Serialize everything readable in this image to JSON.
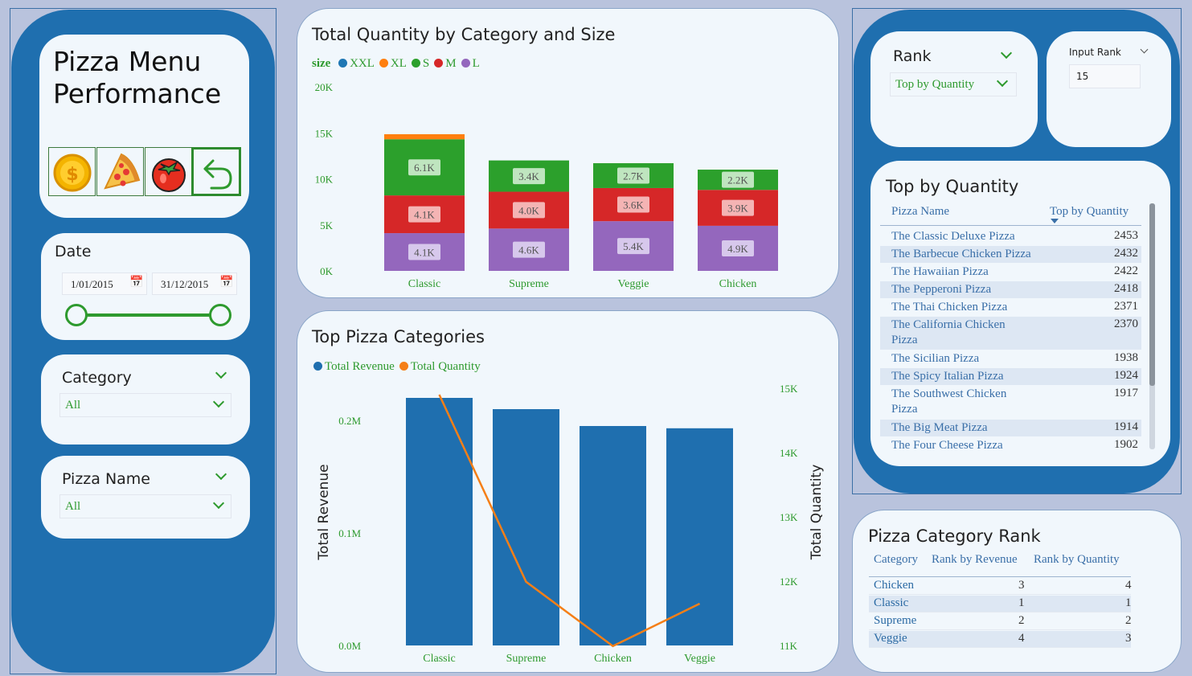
{
  "title": "Pizza Menu Performance",
  "nav_buttons": [
    {
      "icon": "coin-icon"
    },
    {
      "icon": "pizza-slice-icon"
    },
    {
      "icon": "tomato-icon"
    },
    {
      "icon": "back-arrow-icon"
    }
  ],
  "date_slicer": {
    "title": "Date",
    "start": "1/01/2015",
    "end": "31/12/2015"
  },
  "category_slicer": {
    "title": "Category",
    "value": "All"
  },
  "pizza_name_slicer": {
    "title": "Pizza Name",
    "value": "All"
  },
  "chart1": {
    "title": "Total Quantity by Category and Size",
    "legend_title": "size",
    "chart_data": {
      "type": "bar",
      "categories": [
        "Classic",
        "Supreme",
        "Veggie",
        "Chicken"
      ],
      "ylim": [
        0,
        20000
      ],
      "y_ticks": [
        "0K",
        "5K",
        "10K",
        "15K",
        "20K"
      ],
      "series": [
        {
          "name": "XXL",
          "color": "#1f77b4",
          "values": [
            0,
            0,
            0,
            0
          ]
        },
        {
          "name": "XL",
          "color": "#ff7f0e",
          "values": [
            550,
            0,
            0,
            0
          ]
        },
        {
          "name": "S",
          "color": "#2ca02c",
          "values": [
            6100,
            3400,
            2700,
            2200
          ],
          "labels": [
            "6.1K",
            "3.4K",
            "2.7K",
            "2.2K"
          ]
        },
        {
          "name": "M",
          "color": "#d62728",
          "values": [
            4100,
            4000,
            3600,
            3900
          ],
          "labels": [
            "4.1K",
            "4.0K",
            "3.6K",
            "3.9K"
          ]
        },
        {
          "name": "L",
          "color": "#9467bd",
          "values": [
            4100,
            4600,
            5400,
            4900
          ],
          "labels": [
            "4.1K",
            "4.6K",
            "5.4K",
            "4.9K"
          ]
        }
      ]
    }
  },
  "chart2": {
    "title": "Top Pizza Categories",
    "chart_data": {
      "type": "bar",
      "categories": [
        "Classic",
        "Supreme",
        "Chicken",
        "Veggie"
      ],
      "ylabel": "Total Revenue",
      "y2label": "Total Quantity",
      "y_ticks": [
        "0.0M",
        "0.1M",
        "0.2M"
      ],
      "y2_ticks": [
        "11K",
        "12K",
        "13K",
        "14K",
        "15K"
      ],
      "ylim": [
        0,
        0.24
      ],
      "y2lim": [
        11000,
        15200
      ],
      "series": [
        {
          "name": "Total Revenue",
          "color": "#1f6faf",
          "values": [
            0.22,
            0.21,
            0.195,
            0.193
          ]
        },
        {
          "name": "Total Quantity",
          "color": "#f57f17",
          "values": [
            14900,
            11990,
            10990,
            11650
          ]
        }
      ]
    }
  },
  "rank_slicer": {
    "title": "Rank",
    "value": "Top by Quantity"
  },
  "input_rank": {
    "title": "Input Rank",
    "value": "15"
  },
  "top_table": {
    "title": "Top by Quantity",
    "col1": "Pizza Name",
    "col2": "Top by Quantity",
    "rows": [
      {
        "name": "The Classic Deluxe Pizza",
        "value": "2453"
      },
      {
        "name": "The Barbecue Chicken Pizza",
        "value": "2432"
      },
      {
        "name": "The Hawaiian Pizza",
        "value": "2422"
      },
      {
        "name": "The Pepperoni Pizza",
        "value": "2418"
      },
      {
        "name": "The Thai Chicken Pizza",
        "value": "2371"
      },
      {
        "name": "The California Chicken",
        "name2": "Pizza",
        "value": "2370"
      },
      {
        "name": "The Sicilian Pizza",
        "value": "1938"
      },
      {
        "name": "The Spicy Italian Pizza",
        "value": "1924"
      },
      {
        "name": "The Southwest Chicken",
        "name2": "Pizza",
        "value": "1917"
      },
      {
        "name": "The Big Meat Pizza",
        "value": "1914"
      },
      {
        "name": "The Four Cheese Pizza",
        "value": "1902"
      }
    ]
  },
  "cat_rank": {
    "title": "Pizza Category Rank",
    "headers": [
      "Category",
      "Rank by Revenue",
      "Rank by Quantity"
    ],
    "rows": [
      {
        "category": "Chicken",
        "rev": "3",
        "qty": "4"
      },
      {
        "category": "Classic",
        "rev": "1",
        "qty": "1"
      },
      {
        "category": "Supreme",
        "rev": "2",
        "qty": "2"
      },
      {
        "category": "Veggie",
        "rev": "4",
        "qty": "3"
      }
    ]
  }
}
